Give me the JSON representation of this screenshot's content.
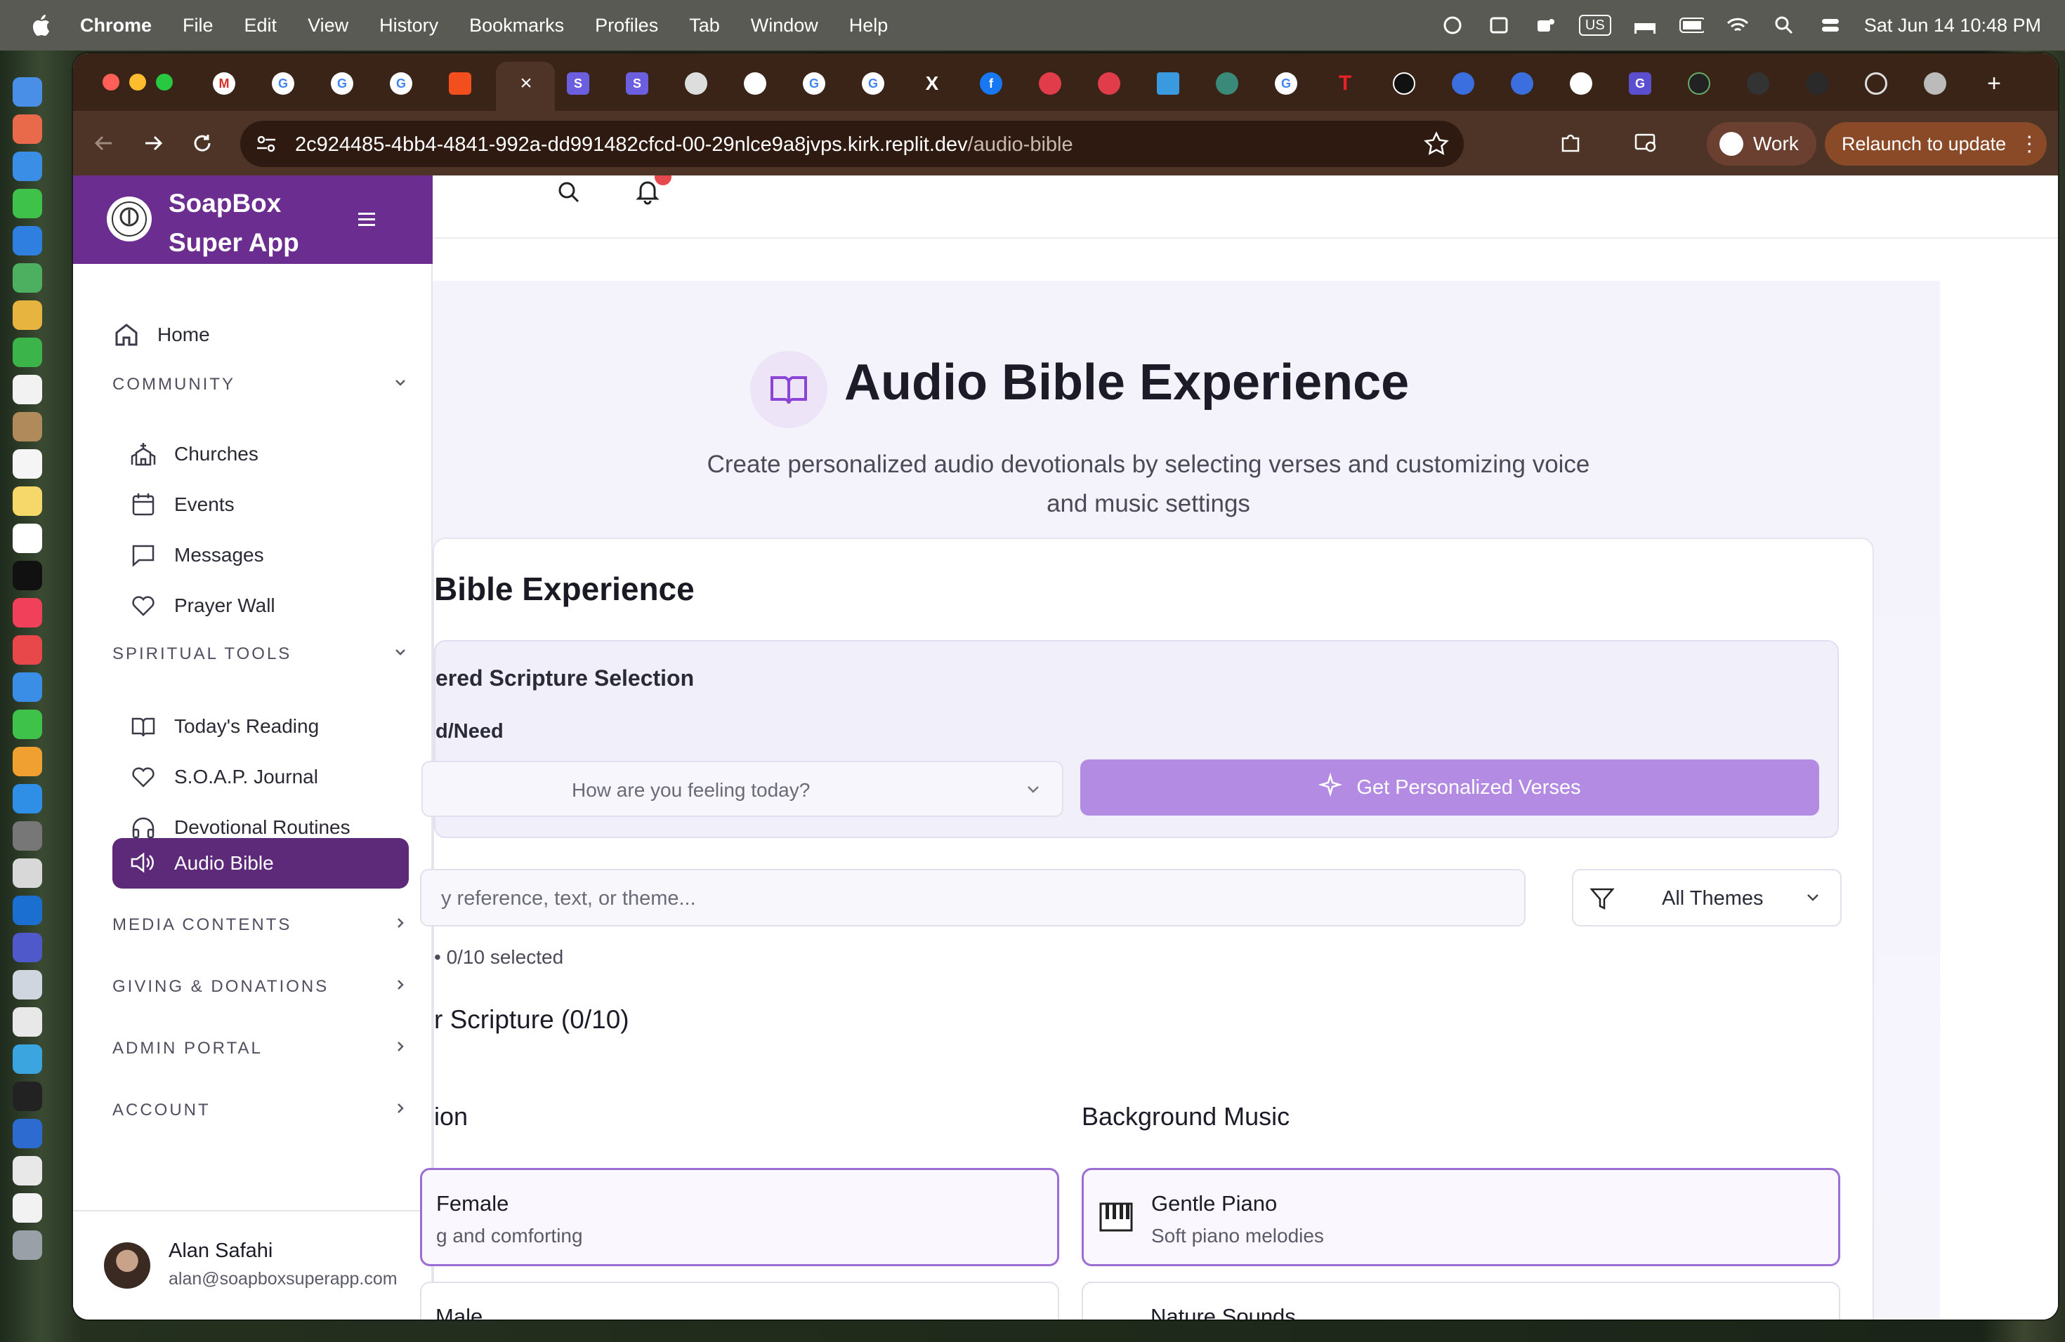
{
  "menubar": {
    "app": "Chrome",
    "items": [
      "File",
      "Edit",
      "View",
      "History",
      "Bookmarks",
      "Profiles",
      "Tab",
      "Window",
      "Help"
    ],
    "input_indicator": "US",
    "datetime": "Sat Jun 14  10:48 PM"
  },
  "browser": {
    "url_main": "2c924485-4bb4-4841-992a-dd991482cfcd-00-29nlce9a8jvps.kirk.replit.dev",
    "url_path": "/audio-bible",
    "profile_label": "Work",
    "relaunch_label": "Relaunch to update"
  },
  "sidebar": {
    "brand_line1": "SoapBox",
    "brand_line2": "Super App",
    "home": "Home",
    "community": "COMMUNITY",
    "churches": "Churches",
    "events": "Events",
    "messages": "Messages",
    "prayer_wall": "Prayer Wall",
    "spiritual_tools": "SPIRITUAL TOOLS",
    "todays_reading": "Today's Reading",
    "soap_journal": "S.O.A.P. Journal",
    "devotional_routines": "Devotional Routines",
    "audio_bible": "Audio Bible",
    "media_contents": "MEDIA CONTENTS",
    "giving": "GIVING & DONATIONS",
    "admin_portal": "ADMIN PORTAL",
    "account": "ACCOUNT",
    "user_name": "Alan Safahi",
    "user_email": "alan@soapboxsuperapp.com"
  },
  "main": {
    "hero_title": "Audio Bible Experience",
    "hero_subtitle_line1": "Create personalized audio devotionals by selecting verses and customizing voice",
    "hero_subtitle_line2": "and music settings",
    "card_title": "Bible Experience",
    "ai_title": "ered Scripture Selection",
    "mood_label": "d/Need",
    "mood_placeholder": "How are you feeling today?",
    "get_button": "Get Personalized Verses",
    "search_placeholder": "y reference, text, or theme...",
    "theme_filter": "All Themes",
    "selected_count": "• 0/10 selected",
    "your_scripture": "r Scripture (0/10)",
    "voice_heading": "ion",
    "music_heading": "Background Music",
    "voice_opt1_title": "Female",
    "voice_opt1_desc": "g and comforting",
    "voice_opt2_title": "Male",
    "music_opt1_title": "Gentle Piano",
    "music_opt1_desc": "Soft piano melodies",
    "music_opt2_title": "Nature Sounds"
  }
}
